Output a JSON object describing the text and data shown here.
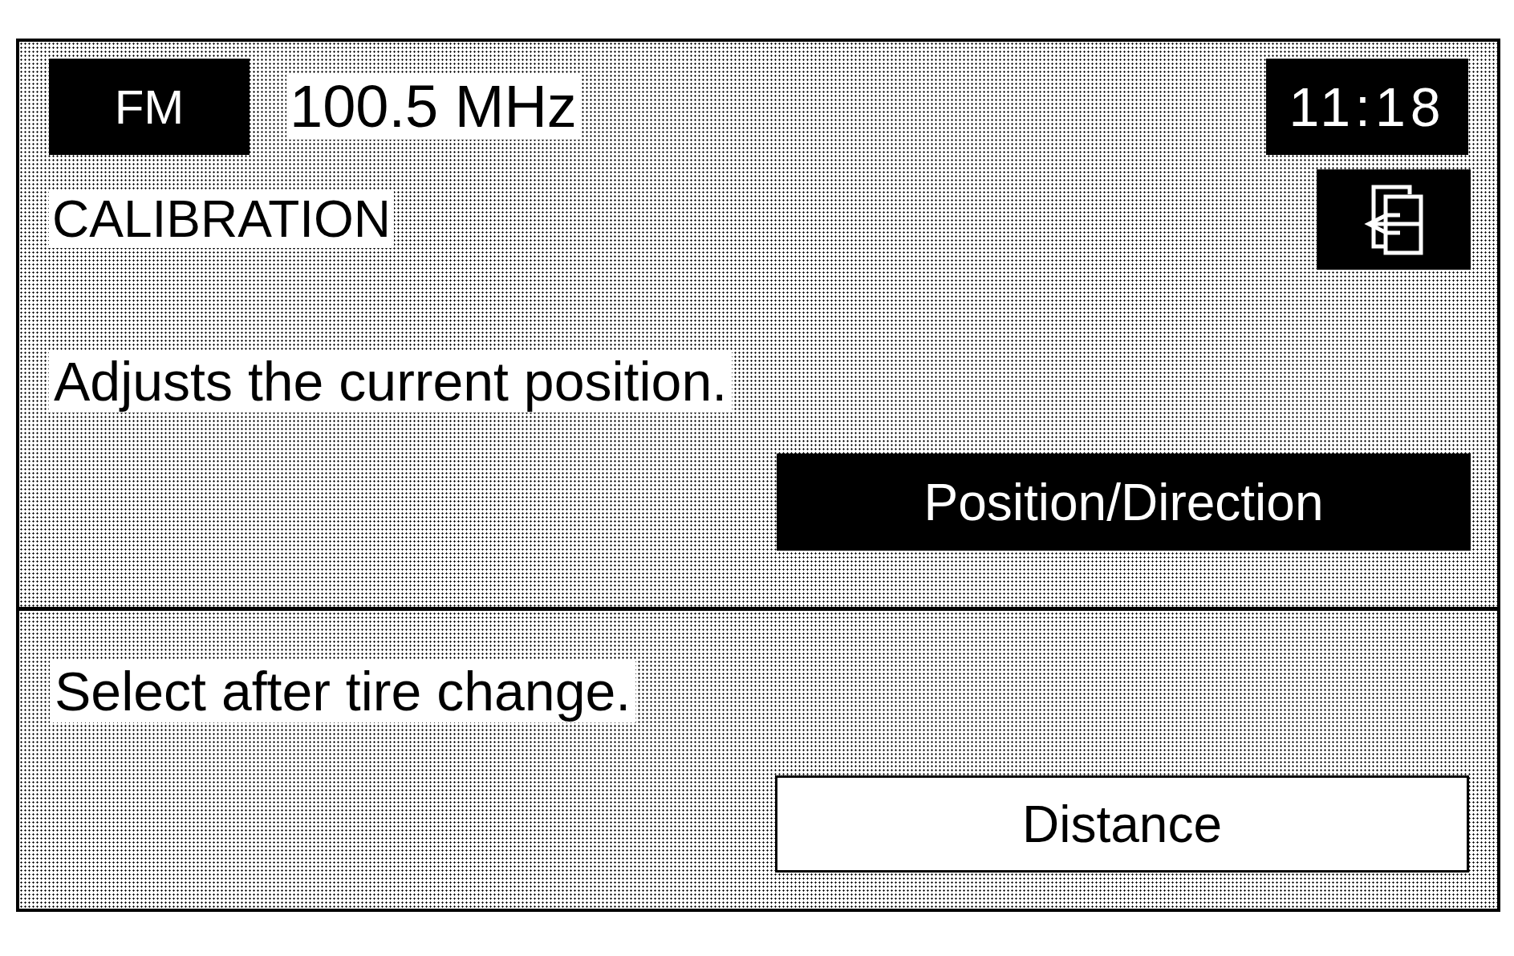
{
  "header": {
    "band": "FM",
    "frequency": "100.5 MHz",
    "clock": "11:18"
  },
  "screen": {
    "title": "CALIBRATION"
  },
  "sections": [
    {
      "description": "Adjusts the current position.",
      "button": {
        "label": "Position/Direction",
        "selected": true
      }
    },
    {
      "description": "Select after tire change.",
      "button": {
        "label": "Distance",
        "selected": false
      }
    }
  ]
}
